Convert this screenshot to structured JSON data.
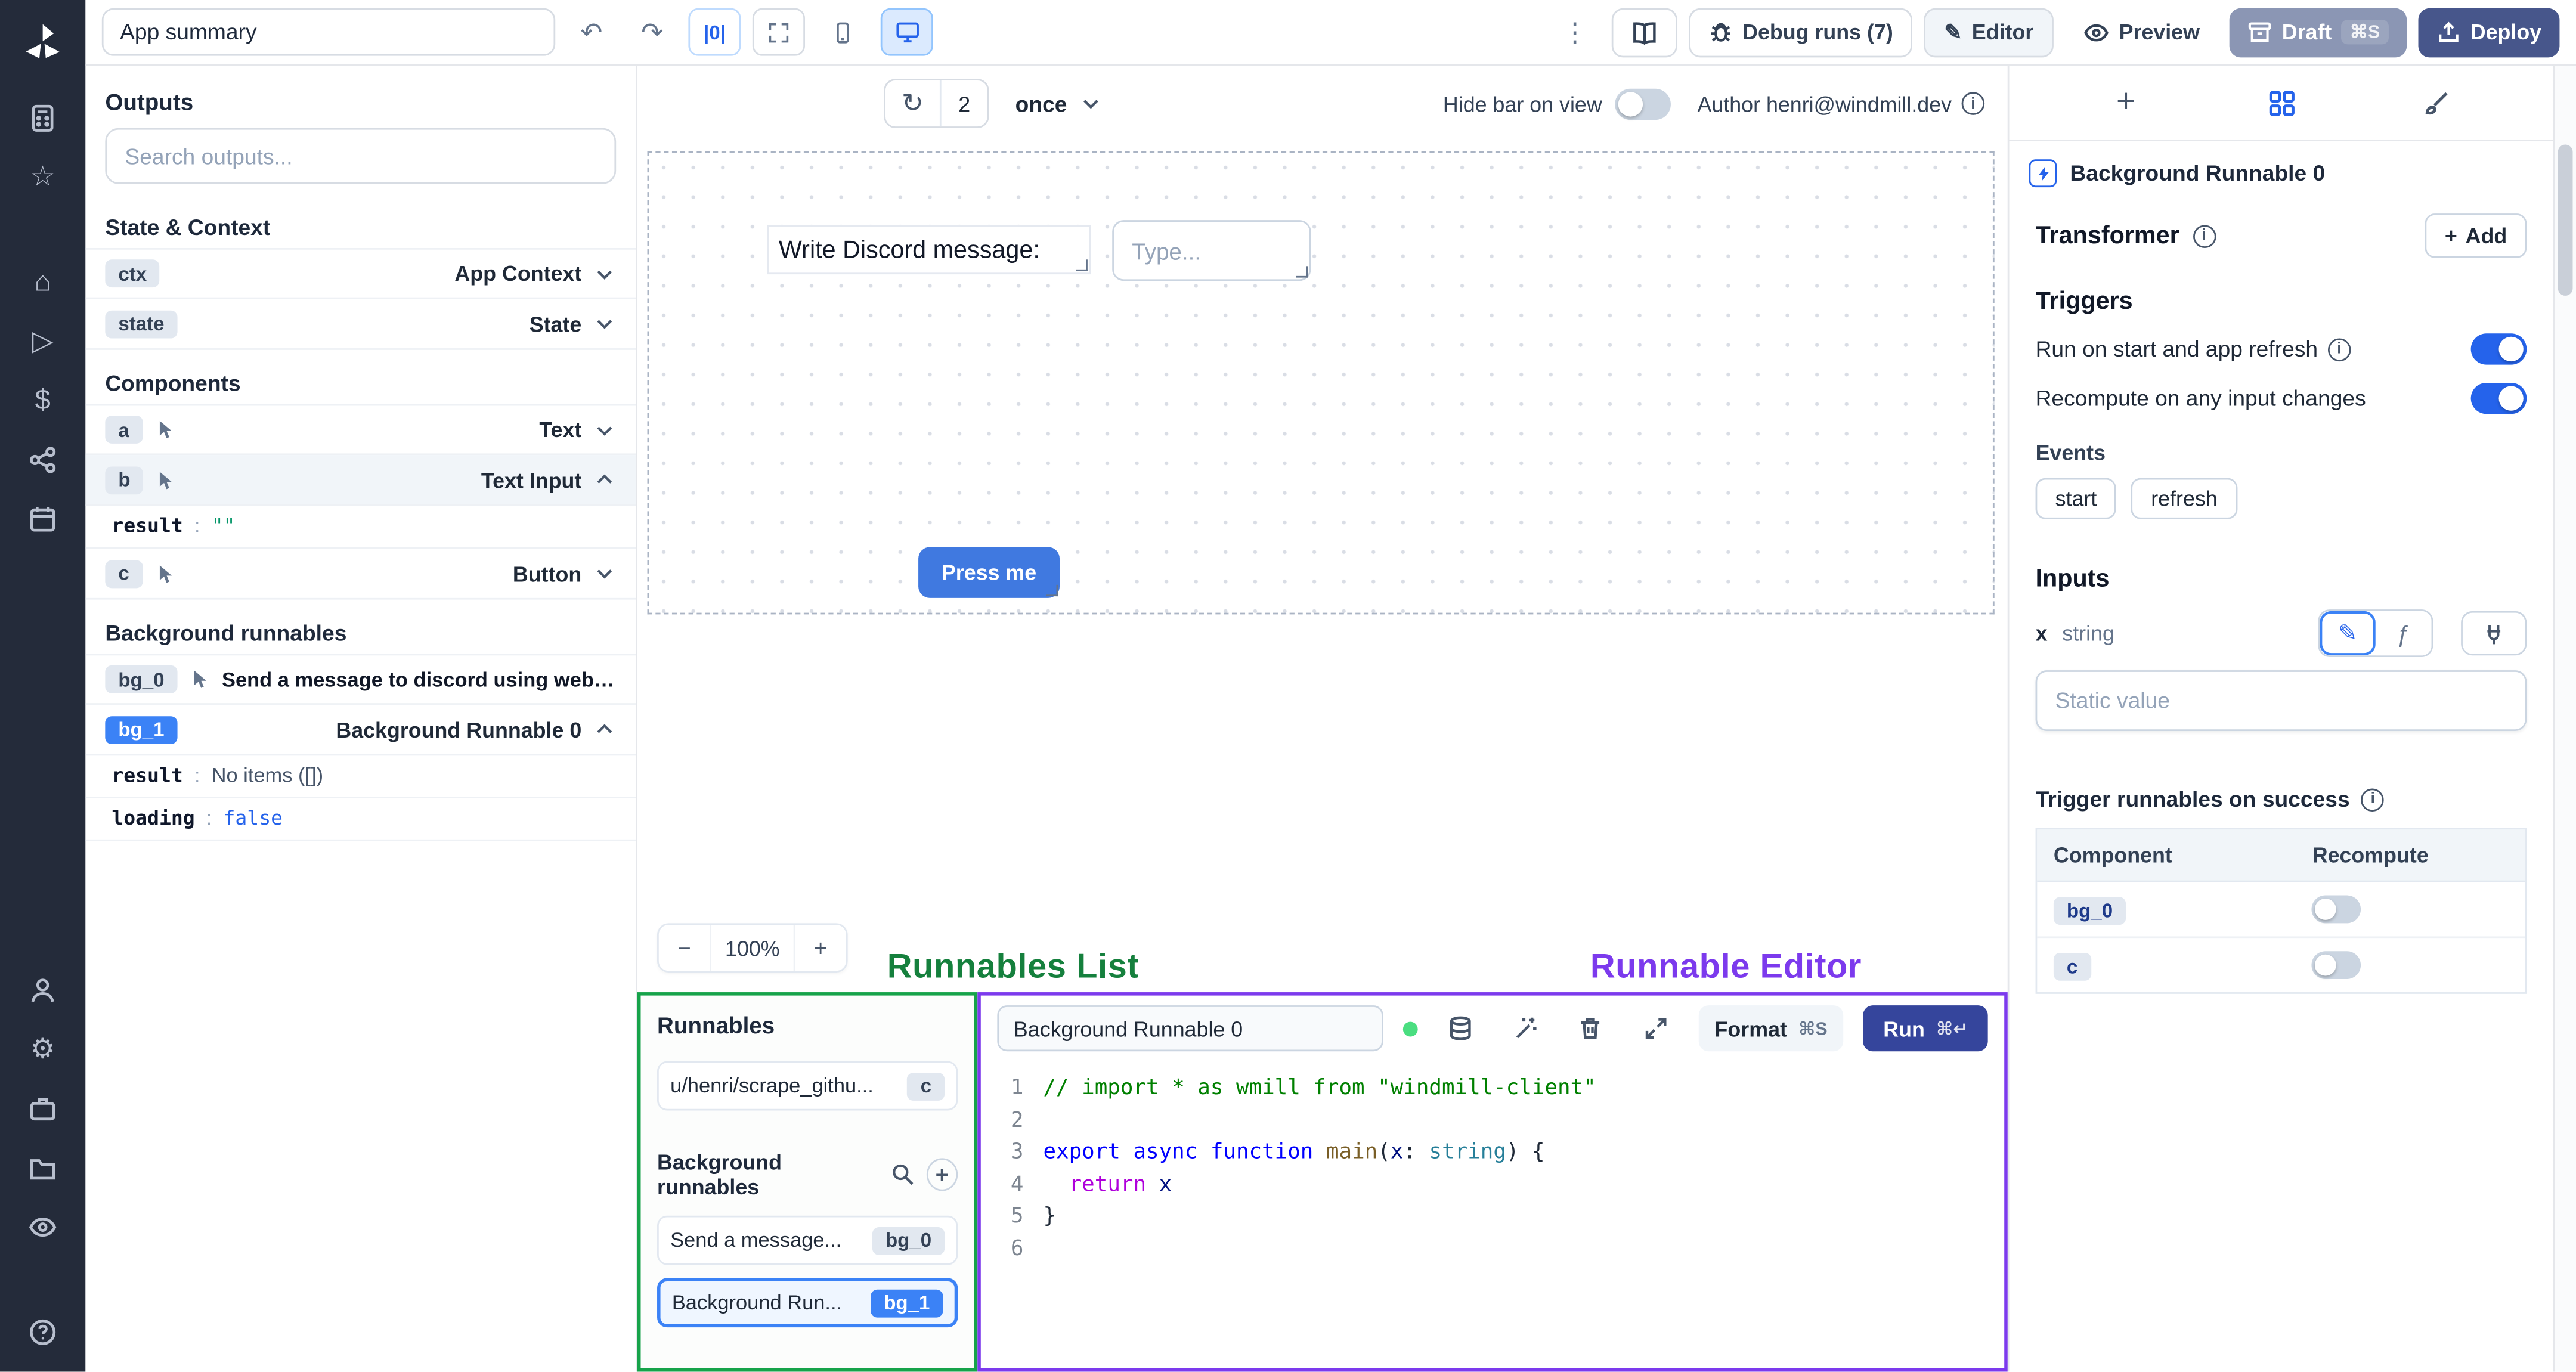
{
  "icons": {
    "undo": "↶",
    "redo": "↷",
    "kebab": "⋮",
    "refresh": "↻",
    "star": "☆",
    "home": "⌂",
    "play": "▷",
    "dollar": "$",
    "gear": "⚙",
    "help": "?",
    "pencil": "✎",
    "fn": "ƒ",
    "align": "|0|",
    "plus": "+",
    "minus": "−",
    "cmd_s": "⌘S",
    "cmd_enter": "⌘↵"
  },
  "topbar": {
    "summary_value": "App summary",
    "debug_runs": "Debug runs (7)",
    "editor": "Editor",
    "preview": "Preview",
    "draft": "Draft",
    "deploy": "Deploy"
  },
  "canvas_toolbar": {
    "refresh_count": "2",
    "interval": "once",
    "hide_bar": "Hide bar on view",
    "author": "Author henri@windmill.dev"
  },
  "canvas": {
    "text_component": "Write Discord message:",
    "input_placeholder": "Type...",
    "button_label": "Press me",
    "zoom": "100%"
  },
  "overlay": {
    "runnables_list": "Runnables List",
    "runnable_editor": "Runnable Editor"
  },
  "outputs": {
    "title": "Outputs",
    "search_placeholder": "Search outputs...",
    "state_section": "State & Context",
    "state_rows": [
      {
        "badge": "ctx",
        "label": "App Context"
      },
      {
        "badge": "state",
        "label": "State"
      }
    ],
    "components_section": "Components",
    "component_rows": [
      {
        "badge": "a",
        "label": "Text"
      },
      {
        "badge": "b",
        "label": "Text Input"
      },
      {
        "badge": "c",
        "label": "Button"
      }
    ],
    "b_result": {
      "key": "result",
      "sep": ":",
      "value": "\"\""
    },
    "bg_section": "Background runnables",
    "bg_rows": [
      {
        "badge": "bg_0",
        "label": "Send a message to discord using webhoo"
      },
      {
        "badge": "bg_1",
        "label": "Background Runnable 0"
      }
    ],
    "bg1_details": [
      {
        "key": "result",
        "sep": ":",
        "value": "No items ([])"
      },
      {
        "key": "loading",
        "sep": ":",
        "value": "false"
      }
    ]
  },
  "runnables_panel": {
    "title": "Runnables",
    "script_item": {
      "label": "u/henri/scrape_githu...",
      "badge": "c"
    },
    "bg_header": "Background runnables",
    "bg_items": [
      {
        "label": "Send a message...",
        "badge": "bg_0"
      },
      {
        "label": "Background Run...",
        "badge": "bg_1"
      }
    ]
  },
  "editor": {
    "name_value": "Background Runnable 0",
    "format": "Format",
    "run": "Run",
    "code_lines": [
      [
        {
          "t": "// import * as wmill from \"windmill-client\"",
          "c": "comment"
        }
      ],
      [],
      [
        {
          "t": "export",
          "c": "kw"
        },
        {
          "t": " ",
          "c": "pl"
        },
        {
          "t": "async",
          "c": "kw"
        },
        {
          "t": " ",
          "c": "pl"
        },
        {
          "t": "function",
          "c": "kw"
        },
        {
          "t": " ",
          "c": "pl"
        },
        {
          "t": "main",
          "c": "fn"
        },
        {
          "t": "(",
          "c": "pl"
        },
        {
          "t": "x",
          "c": "var"
        },
        {
          "t": ": ",
          "c": "pl"
        },
        {
          "t": "string",
          "c": "type"
        },
        {
          "t": ") {",
          "c": "pl"
        }
      ],
      [
        {
          "t": "  ",
          "c": "pl"
        },
        {
          "t": "return",
          "c": "ctrl"
        },
        {
          "t": " x",
          "c": "var"
        }
      ],
      [
        {
          "t": "}",
          "c": "pl"
        }
      ],
      []
    ]
  },
  "right_panel": {
    "header_title": "Background Runnable 0",
    "transformer_label": "Transformer",
    "add_label": "Add",
    "triggers_title": "Triggers",
    "trigger_row1": "Run on start and app refresh",
    "trigger_row2": "Recompute on any input changes",
    "events_label": "Events",
    "event_badges": [
      "start",
      "refresh"
    ],
    "inputs_title": "Inputs",
    "field_name": "x",
    "field_type": "string",
    "static_placeholder": "Static value",
    "success_title": "Trigger runnables on success",
    "table": {
      "col_component": "Component",
      "col_recompute": "Recompute",
      "rows": [
        {
          "badge": "bg_0"
        },
        {
          "badge": "c"
        }
      ]
    }
  },
  "colors": {
    "accent": "#3b82f6",
    "runnables_green": "#15803d",
    "editor_purple": "#7c3aed"
  }
}
